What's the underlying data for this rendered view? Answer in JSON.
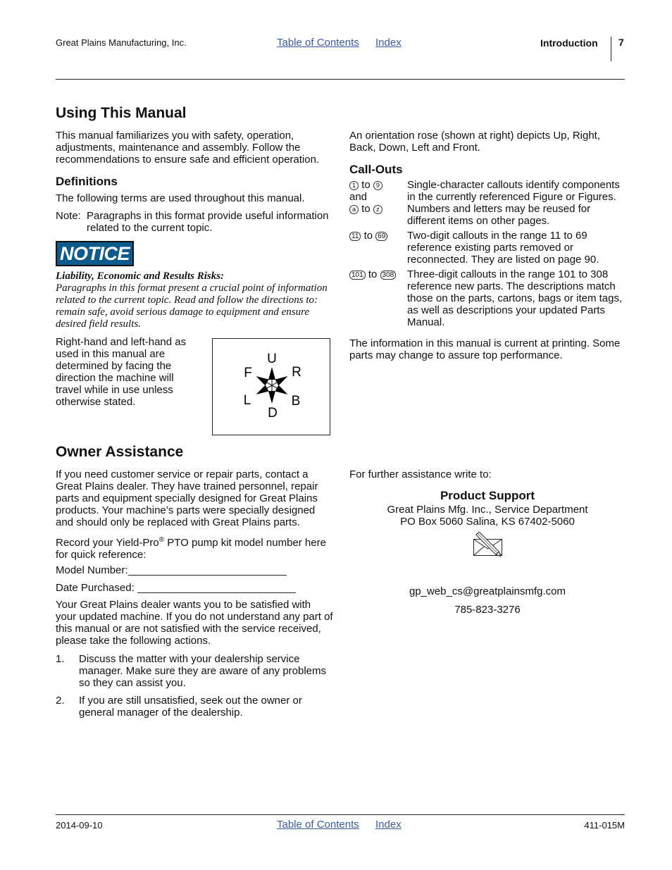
{
  "header": {
    "company": "Great Plains Manufacturing, Inc.",
    "toc_link": "Table of Contents",
    "index_link": "Index",
    "section": "Introduction",
    "page_number": "7"
  },
  "using_manual": {
    "title": "Using This Manual",
    "intro": "This manual familiarizes you with safety, operation, adjustments, maintenance and assembly. Follow the recommendations to ensure safe and efficient operation.",
    "definitions_title": "Definitions",
    "definitions_text": "The following terms are used throughout this manual.",
    "note_label": "Note:",
    "note_text": "Paragraphs in this format provide useful information related to the current topic.",
    "notice_badge": "NOTICE",
    "notice_heading": "Liability, Economic and Results Risks:",
    "notice_text": "Paragraphs in this format present a crucial point of information related to the current topic. Read and follow the directions to: remain safe, avoid serious damage to equipment and ensure desired field results.",
    "handedness_text": "Right-hand and left-hand as used in this manual are determined by facing the direction the machine will travel while in use unless otherwise stated.",
    "rose_labels": {
      "up": "U",
      "down": "D",
      "front": "F",
      "right": "R",
      "left": "L",
      "back": "B"
    },
    "rose_text": "An orientation rose (shown at right) depicts Up, Right, Back, Down, Left and Front."
  },
  "callouts": {
    "title": "Call-Outs",
    "rows": [
      {
        "key_parts": [
          "1",
          "to",
          "9",
          "and",
          "a",
          "to",
          "z"
        ],
        "text": "Single-character callouts identify components in the currently referenced Figure or Figures. Numbers and letters may be reused for different items on other pages."
      },
      {
        "key_parts": [
          "11",
          "to",
          "69"
        ],
        "text": "Two-digit callouts in the range 11 to 69 reference existing parts removed or reconnected. They are listed on page 90."
      },
      {
        "key_parts": [
          "101",
          "to",
          "308"
        ],
        "text": "Three-digit callouts in the range 101 to 308 reference new parts. The descriptions match those on the parts, cartons, bags or item tags, as well as descriptions your updated Parts Manual."
      }
    ],
    "footer_text": "The information in this manual is current at printing. Some parts may change to assure top performance."
  },
  "owner_assistance": {
    "title": "Owner Assistance",
    "intro": "If you need customer service or repair parts, contact a Great Plains dealer. They have trained personnel, repair parts and equipment specially designed for Great Plains products. Your machine’s parts were specially designed and should only be replaced with Great Plains parts.",
    "record_prefix": "Record your Yield-Pro",
    "record_reg": "®",
    "record_suffix": " PTO pump kit model number here for quick reference:",
    "model_number_label": "Model Number:",
    "model_number_value": "",
    "date_purchased_label": "Date Purchased:",
    "date_purchased_value": "",
    "satisfaction_text": "Your Great Plains dealer wants you to be satisfied with your updated machine. If you do not understand any part of this manual or are not satisfied with the service received, please take the following actions.",
    "steps": [
      {
        "num": "1.",
        "text": "Discuss the matter with your dealership service manager. Make sure they are aware of any problems so they can assist you."
      },
      {
        "num": "2.",
        "text": "If you are still unsatisfied, seek out the owner or general manager of the dealership."
      }
    ],
    "write_to": "For further assistance write to:",
    "contact_title": "Product Support",
    "contact_line1": "Great Plains Mfg. Inc., Service Department",
    "contact_line2": "PO Box 5060 Salina, KS 67402-5060",
    "mail_icon": "envelope-pencil-icon",
    "email": "gp_web_cs@greatplainsmfg.com",
    "phone": "785-823-3276"
  },
  "footer": {
    "date": "2014-09-10",
    "toc_link": "Table of Contents",
    "index_link": "Index",
    "doc_number": "411-015M"
  },
  "colors": {
    "link": "#3a5aa0",
    "notice_bg": "#0d5a8c"
  }
}
